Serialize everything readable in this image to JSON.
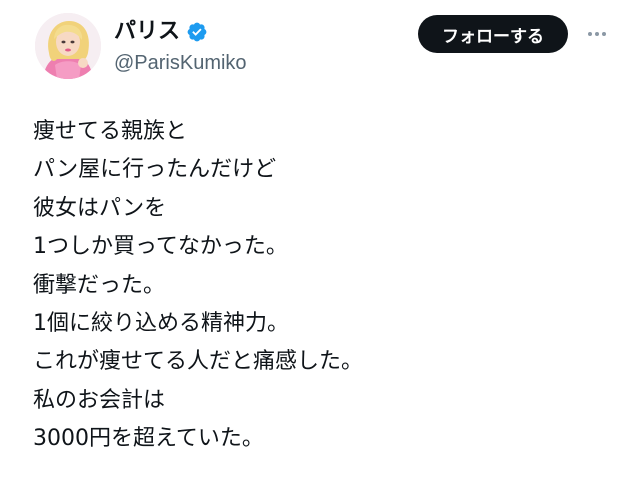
{
  "author": {
    "display_name": "パリス",
    "handle": "@ParisKumiko",
    "verified": true,
    "verified_color": "#1d9bf0"
  },
  "actions": {
    "follow_label": "フォローする",
    "more_icon": "more-horizontal-icon"
  },
  "tweet": {
    "lines": [
      "痩せてる親族と",
      "パン屋に行ったんだけど",
      "彼女はパンを",
      "1つしか買ってなかった。",
      "衝撃だった。",
      "1個に絞り込める精神力。",
      "これが痩せてる人だと痛感した。",
      "私のお会計は",
      "3000円を超えていた。"
    ]
  },
  "colors": {
    "text": "#0f1419",
    "secondary": "#536471",
    "button_bg": "#0f1419"
  }
}
